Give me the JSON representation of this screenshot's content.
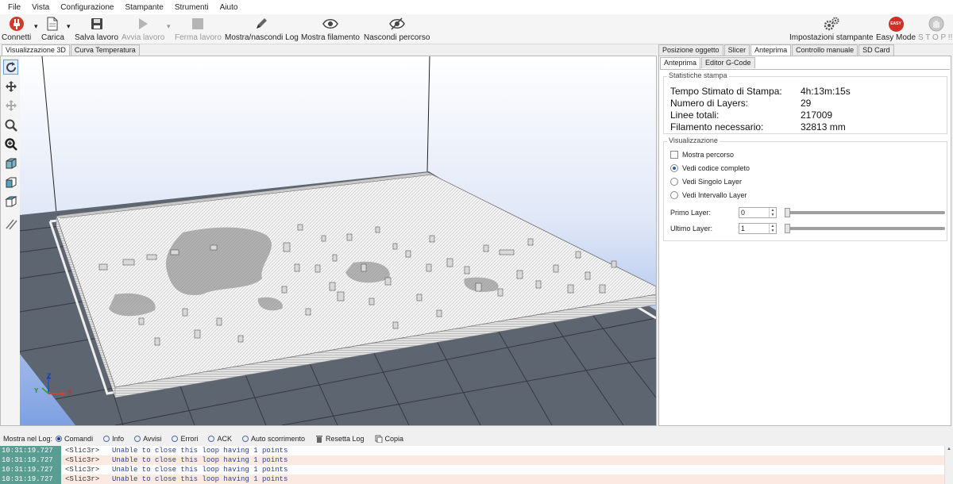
{
  "menu": [
    "File",
    "Vista",
    "Configurazione",
    "Stampante",
    "Strumenti",
    "Aiuto"
  ],
  "toolbar": {
    "connect": "Connetti",
    "load": "Carica",
    "save": "Salva lavoro",
    "start": "Avvia lavoro",
    "stop": "Ferma lavoro",
    "toggle_log": "Mostra/nascondi Log",
    "show_filament": "Mostra filamento",
    "hide_path": "Nascondi percorso",
    "printer_settings": "Impostazioni stampante",
    "easy_mode": "Easy Mode",
    "easy_badge": "EASY",
    "stop_all": "S T O P !!!"
  },
  "left_tabs": [
    "Visualizzazione 3D",
    "Curva Temperatura"
  ],
  "right_tabs": [
    "Posizione oggetto",
    "Slicer",
    "Anteprima",
    "Controllo manuale",
    "SD Card"
  ],
  "sub_tabs": [
    "Anteprima",
    "Editor G-Code"
  ],
  "stats": {
    "title": "Statistiche stampa",
    "rows": [
      {
        "label": "Tempo Stimato di Stampa:",
        "value": "4h:13m:15s"
      },
      {
        "label": "Numero di Layers:",
        "value": "29"
      },
      {
        "label": "Linee totali:",
        "value": "217009"
      },
      {
        "label": "Filamento necessario:",
        "value": "32813 mm"
      }
    ]
  },
  "visual": {
    "title": "Visualizzazione",
    "show_path": "Mostra percorso",
    "full_code": "Vedi codice completo",
    "single_layer": "Vedi Singolo Layer",
    "layer_range": "Vedi Intervallo Layer",
    "first_layer_label": "Primo Layer:",
    "first_layer_value": "0",
    "last_layer_label": "Ultimo Layer:",
    "last_layer_value": "1"
  },
  "axes": {
    "z": "Z",
    "y": "Y",
    "x": "X"
  },
  "logbar": {
    "label": "Mostra nel Log:",
    "commands": "Comandi",
    "info": "Info",
    "warnings": "Avvisi",
    "errors": "Errori",
    "ack": "ACK",
    "autoscroll": "Auto scorrimento",
    "reset": "Resetta Log",
    "copy": "Copia"
  },
  "log": [
    {
      "time": "10:31:19.727",
      "src": "<Slic3r>",
      "msg": "Unable to close this loop having 1 points"
    },
    {
      "time": "10:31:19.727",
      "src": "<Slic3r>",
      "msg": "Unable to close this loop having 1 points"
    },
    {
      "time": "10:31:19.727",
      "src": "<Slic3r>",
      "msg": "Unable to close this loop having 1 points"
    },
    {
      "time": "10:31:19.727",
      "src": "<Slic3r>",
      "msg": "Unable to close this loop having 1 points"
    }
  ],
  "colors": {
    "accent": "#2b5ea7",
    "viewport_sky_top": "#ffffff",
    "viewport_sky_bottom": "#7ea0e2",
    "grid": "#5d6570",
    "log_time": "#5a9e93"
  }
}
